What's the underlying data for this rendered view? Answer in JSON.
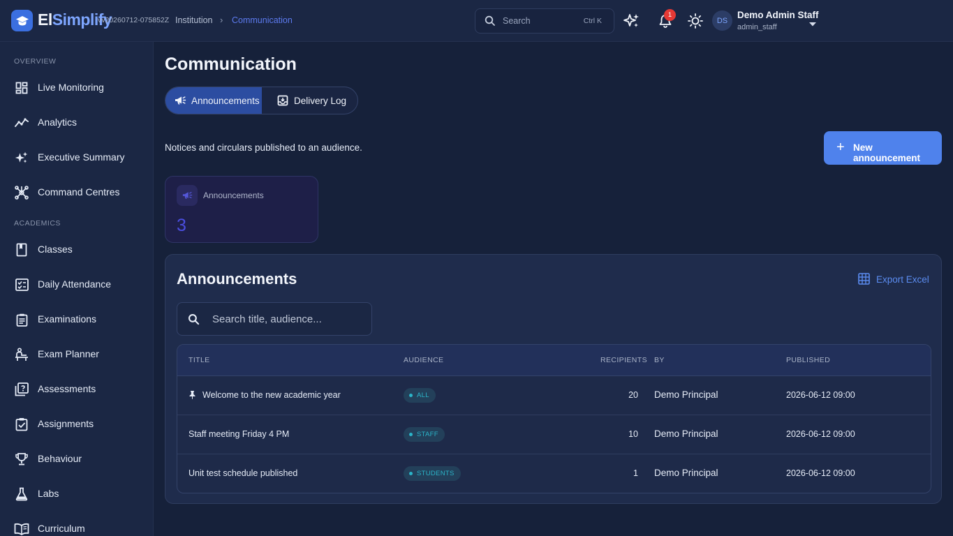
{
  "topbar": {
    "brand_a": "El",
    "brand_b": "Simplify",
    "version": "vv20260712-075852Z",
    "breadcrumb": [
      "Institution",
      "Communication"
    ],
    "search_placeholder": "Search",
    "search_shortcut": "Ctrl K",
    "notification_count": "1",
    "user_initials": "DS",
    "user_name": "Demo Admin Staff",
    "user_role": "admin_staff",
    "icons": [
      "sparkle-icon",
      "bell-icon",
      "sun-icon",
      "chevron-down-icon"
    ]
  },
  "sidebar": {
    "sections": [
      {
        "heading": "OVERVIEW",
        "items": [
          {
            "label": "Live Monitoring",
            "icon": "dashboard-icon"
          },
          {
            "label": "Analytics",
            "icon": "trend-icon"
          },
          {
            "label": "Executive Summary",
            "icon": "sparkle-icon"
          },
          {
            "label": "Command Centres",
            "icon": "hub-icon"
          }
        ]
      },
      {
        "heading": "ACADEMICS",
        "items": [
          {
            "label": "Classes",
            "icon": "book-icon"
          },
          {
            "label": "Daily Attendance",
            "icon": "checklist-icon"
          },
          {
            "label": "Examinations",
            "icon": "document-icon"
          },
          {
            "label": "Exam Planner",
            "icon": "desk-icon"
          },
          {
            "label": "Assessments",
            "icon": "quiz-icon"
          },
          {
            "label": "Assignments",
            "icon": "task-icon"
          },
          {
            "label": "Behaviour",
            "icon": "trophy-icon"
          },
          {
            "label": "Labs",
            "icon": "flask-icon"
          },
          {
            "label": "Curriculum",
            "icon": "open-book-icon"
          }
        ]
      }
    ]
  },
  "main": {
    "title": "Communication",
    "tabs": [
      {
        "label": "Announcements",
        "icon": "megaphone-icon",
        "active": true
      },
      {
        "label": "Delivery Log",
        "icon": "inbox-icon",
        "active": false
      }
    ],
    "subtitle": "Notices and circulars published to an audience.",
    "new_button": "New announcement",
    "stat": {
      "label": "Announcements",
      "value": "3"
    },
    "panel": {
      "title": "Announcements",
      "export_label": "Export Excel",
      "search_placeholder": "Search title, audience...",
      "columns": [
        "TITLE",
        "AUDIENCE",
        "RECIPIENTS",
        "BY",
        "PUBLISHED"
      ],
      "rows": [
        {
          "title": "Welcome to the new academic year",
          "pinned": true,
          "audience": "ALL",
          "recipients": "20",
          "by": "Demo Principal",
          "published": "2026-06-12 09:00"
        },
        {
          "title": "Staff meeting Friday 4 PM",
          "pinned": false,
          "audience": "STAFF",
          "recipients": "10",
          "by": "Demo Principal",
          "published": "2026-06-12 09:00"
        },
        {
          "title": "Unit test schedule published",
          "pinned": false,
          "audience": "STUDENTS",
          "recipients": "1",
          "by": "Demo Principal",
          "published": "2026-06-12 09:00"
        }
      ]
    }
  },
  "colors": {
    "accent": "#4f82ec",
    "active_tab": "#2c4da1",
    "badge": "#2bb5c9",
    "stat_value": "#4b4ee0"
  }
}
